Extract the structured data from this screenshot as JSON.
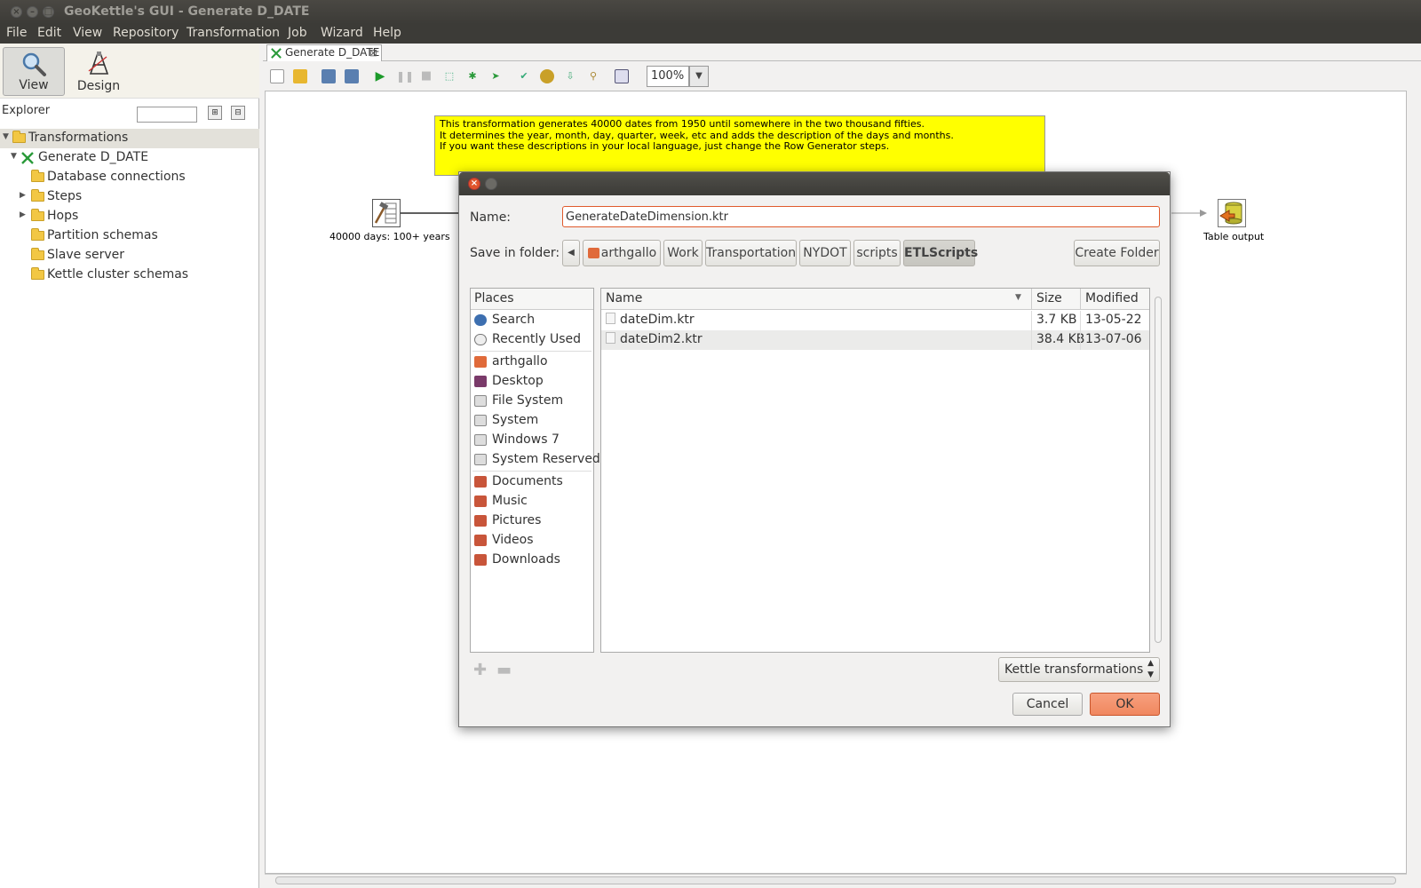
{
  "window": {
    "title": "GeoKettle's GUI - Generate D_DATE"
  },
  "menu": [
    "File",
    "Edit",
    "View",
    "Repository",
    "Transformation",
    "Job",
    "Wizard",
    "Help"
  ],
  "perspectives": {
    "view_label": "View",
    "design_label": "Design"
  },
  "explorer": {
    "label": "Explorer"
  },
  "tree": {
    "transformations": "Transformations",
    "generate": "Generate D_DATE",
    "database_connections": "Database connections",
    "steps": "Steps",
    "hops": "Hops",
    "partition_schemas": "Partition schemas",
    "slave_server": "Slave server",
    "kettle_cluster_schemas": "Kettle cluster schemas"
  },
  "tab": {
    "label": "Generate D_DATE"
  },
  "toolbar": {
    "zoom": "100%"
  },
  "canvas": {
    "note_lines": [
      "This transformation generates 40000 dates from 1950 until somewhere in the two thousand fifties.",
      "It determines the year, month, day, quarter, week, etc and adds the description of the days and months.",
      "If you want these descriptions in your local language, just change the Row Generator steps."
    ],
    "step_generator_label": "40000 days: 100+ years",
    "step_output_label": "Table output"
  },
  "dialog": {
    "name_label": "Name:",
    "name_value": "GenerateDateDimension.ktr",
    "folder_label": "Save in folder:",
    "breadcrumbs": [
      "arthgallo",
      "Work",
      "Transportation",
      "NYDOT",
      "scripts",
      "ETLScripts"
    ],
    "create_folder": "Create Folder",
    "places_header": "Places",
    "places": [
      "Search",
      "Recently Used",
      "arthgallo",
      "Desktop",
      "File System",
      "System",
      "Windows 7",
      "System Reserved",
      "Documents",
      "Music",
      "Pictures",
      "Videos",
      "Downloads"
    ],
    "columns": {
      "name": "Name",
      "size": "Size",
      "modified": "Modified"
    },
    "files": [
      {
        "name": "dateDim.ktr",
        "size": "3.7 KB",
        "modified": "13-05-22"
      },
      {
        "name": "dateDim2.ktr",
        "size": "38.4 KB",
        "modified": "13-07-06"
      }
    ],
    "filter": "Kettle transformations",
    "cancel": "Cancel",
    "ok": "OK"
  },
  "colors": {
    "note_bg": "#ffff00",
    "ok_button": "#f0875f",
    "titlebar": "#3c3b37",
    "name_input_border": "#e05a2c"
  }
}
